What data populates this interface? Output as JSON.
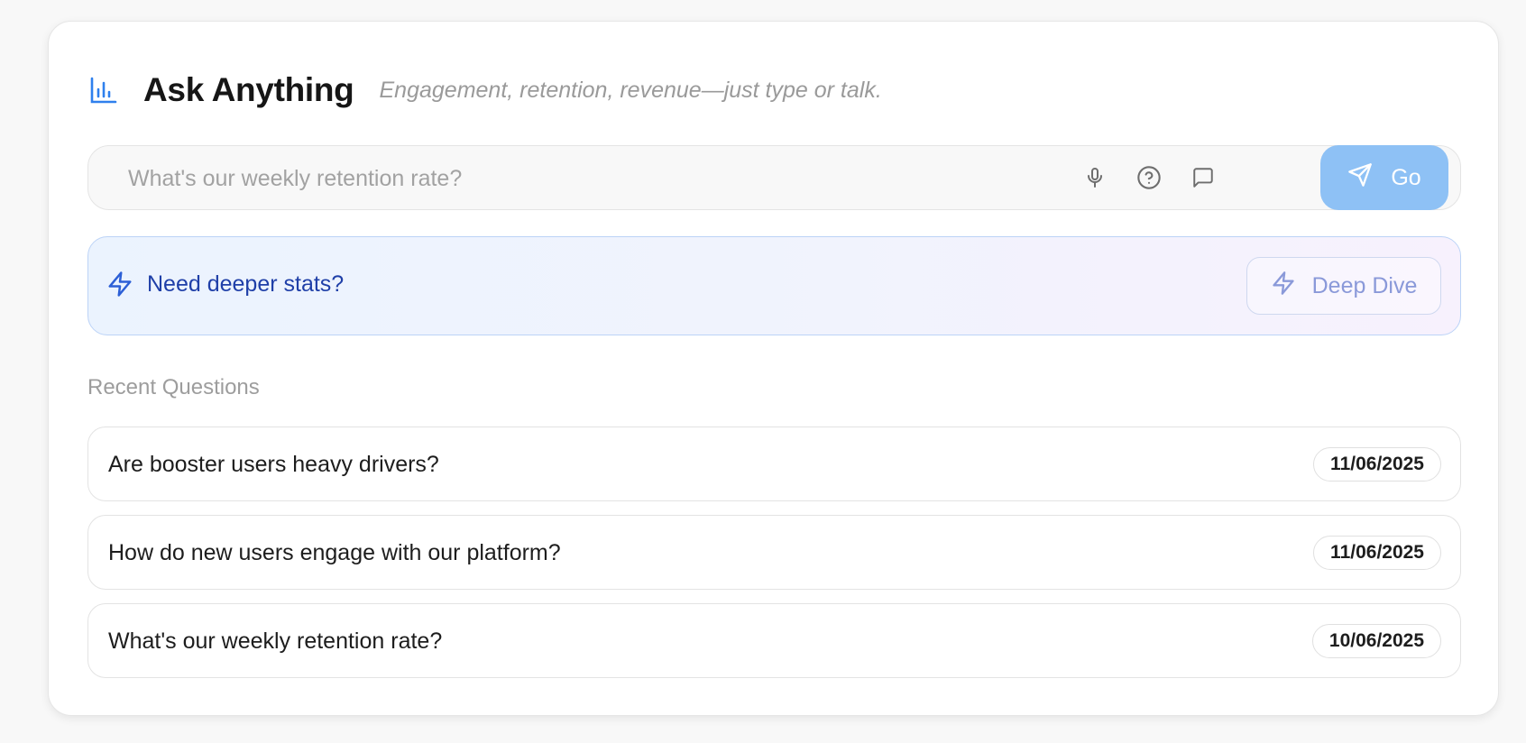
{
  "header": {
    "title": "Ask Anything",
    "subtitle": "Engagement, retention, revenue—just type or talk.",
    "icon": "bar-chart-icon"
  },
  "search": {
    "placeholder": "What's our weekly retention rate?",
    "value": "",
    "icons": [
      "microphone-icon",
      "help-circle-icon",
      "message-icon"
    ],
    "go_label": "Go",
    "go_icon": "send-icon"
  },
  "banner": {
    "text": "Need deeper stats?",
    "icon": "lightning-icon",
    "button_label": "Deep Dive"
  },
  "recent": {
    "label": "Recent Questions",
    "items": [
      {
        "question": "Are booster users heavy drivers?",
        "date": "11/06/2025"
      },
      {
        "question": "How do new users engage with our platform?",
        "date": "11/06/2025"
      },
      {
        "question": "What's our weekly retention rate?",
        "date": "10/06/2025"
      }
    ]
  },
  "colors": {
    "accent": "#2f80ed",
    "go_button": "#8ec1f5",
    "banner_text": "#1f3fa8",
    "deep_dive_text": "#8a99d9"
  }
}
